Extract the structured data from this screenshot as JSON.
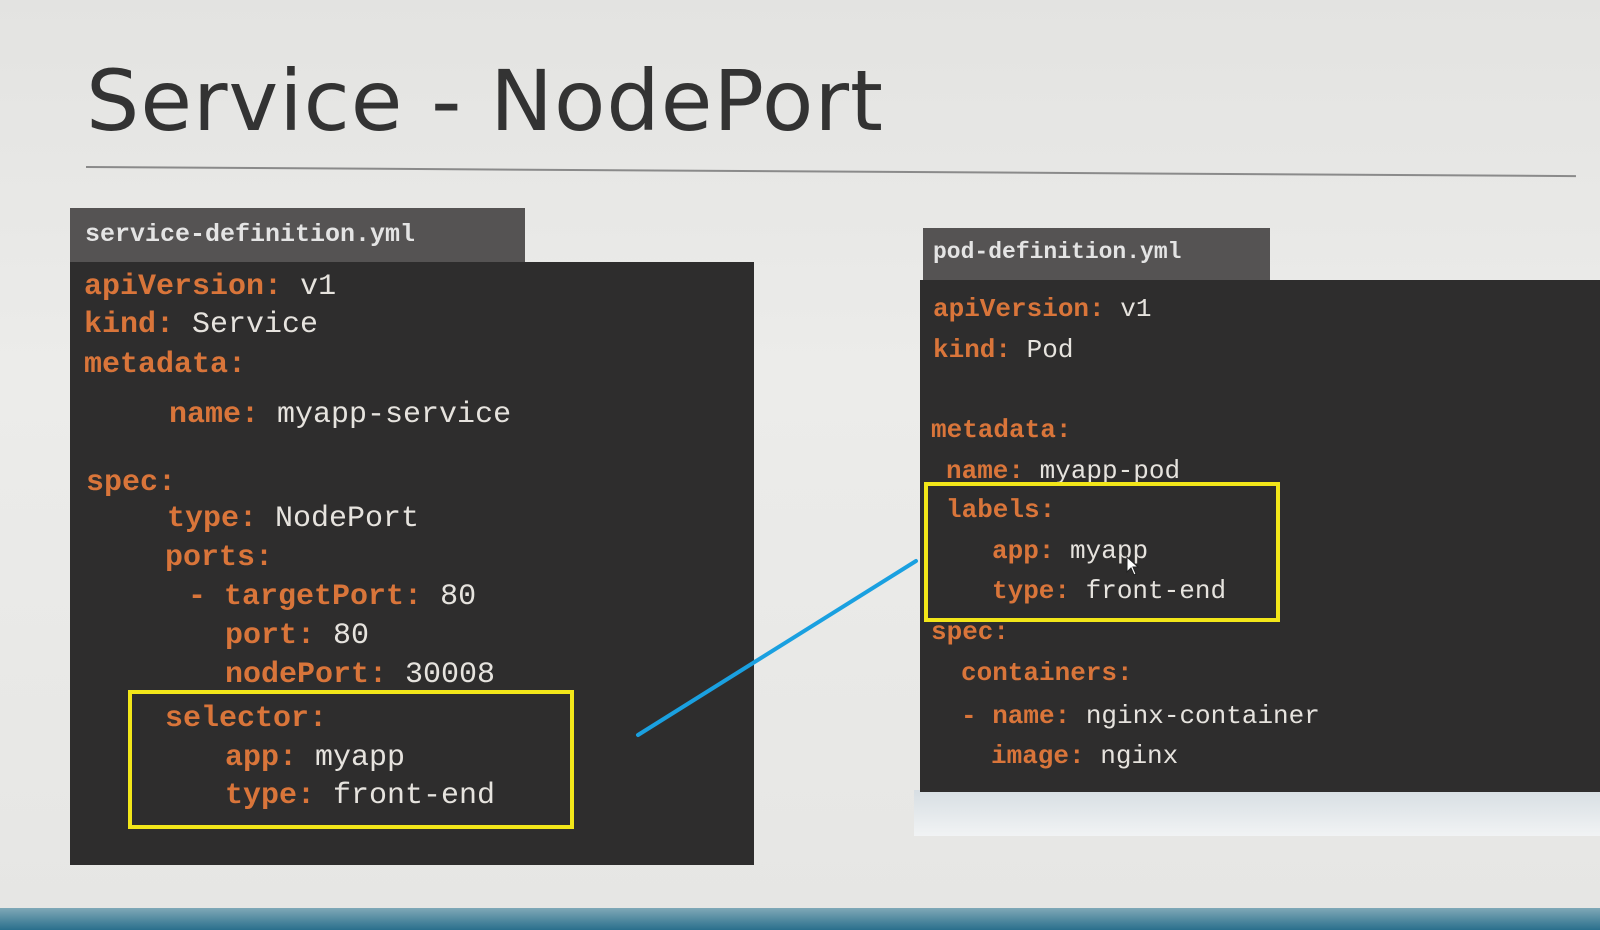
{
  "slide": {
    "title": "Service - NodePort"
  },
  "colors": {
    "key": "#d9753a",
    "value": "#e6e3de",
    "panel": "#2e2d2d",
    "tab": "#555353",
    "highlight": "#f2e619",
    "connector": "#1aa0e0"
  },
  "service_file": {
    "tab_label": "service-definition.yml",
    "lines": [
      {
        "key": "apiVersion:",
        "value": "v1"
      },
      {
        "key": "kind:",
        "value": "Service"
      },
      {
        "key": "metadata:",
        "value": ""
      },
      {
        "key": "name:",
        "value": "myapp-service"
      },
      {
        "key": "spec:",
        "value": ""
      },
      {
        "key": "type:",
        "value": "NodePort"
      },
      {
        "key": "ports:",
        "value": ""
      },
      {
        "key": "- targetPort:",
        "value": "80"
      },
      {
        "key": "port:",
        "value": "80"
      },
      {
        "key": "nodePort:",
        "value": "30008"
      },
      {
        "key": "selector:",
        "value": ""
      },
      {
        "key": "app:",
        "value": "myapp"
      },
      {
        "key": "type:",
        "value": "front-end"
      }
    ]
  },
  "pod_file": {
    "tab_label": "pod-definition.yml",
    "lines": [
      {
        "key": "apiVersion:",
        "value": "v1"
      },
      {
        "key": "kind:",
        "value": "Pod"
      },
      {
        "key": "metadata:",
        "value": ""
      },
      {
        "key": "name:",
        "value": "myapp-pod"
      },
      {
        "key": "labels:",
        "value": ""
      },
      {
        "key": "app:",
        "value": "myapp"
      },
      {
        "key": "type:",
        "value": "front-end"
      },
      {
        "key": "spec:",
        "value": ""
      },
      {
        "key": "containers:",
        "value": ""
      },
      {
        "key": "- name:",
        "value": "nginx-container"
      },
      {
        "key": "image:",
        "value": "nginx"
      }
    ]
  }
}
